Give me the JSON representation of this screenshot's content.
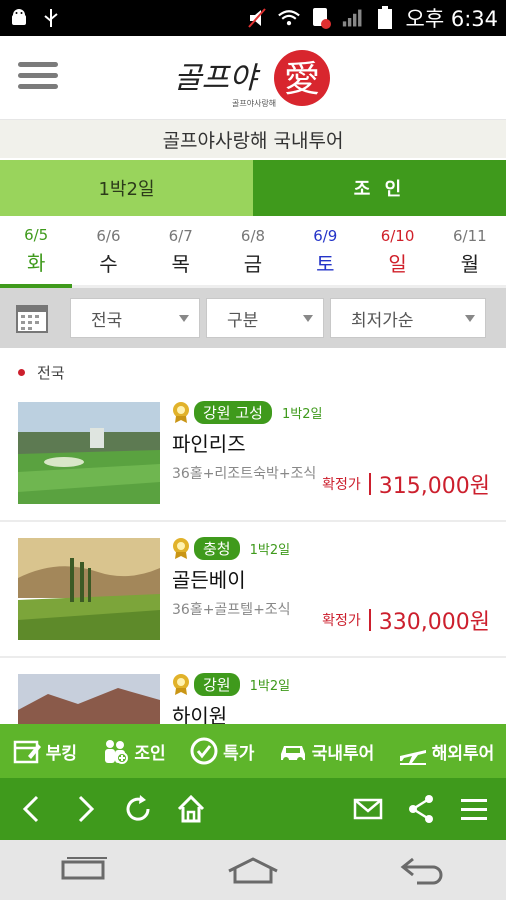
{
  "status_bar": {
    "time": "오후 6:34",
    "left_icons": [
      "android-icon",
      "usb-icon"
    ],
    "right_icons": [
      "mute-icon",
      "wifi-icon",
      "sim-icon",
      "signal-icon",
      "battery-icon"
    ]
  },
  "header": {
    "logo_text": "골프야",
    "logo_small": "골프야사랑해",
    "logo_symbol": "愛",
    "subtitle": "골프야사랑해 국내투어"
  },
  "mode_tabs": [
    {
      "label": "1박2일",
      "active": false
    },
    {
      "label": "조 인",
      "active": true
    }
  ],
  "dates": [
    {
      "date": "6/5",
      "day": "화",
      "active": true
    },
    {
      "date": "6/6",
      "day": "수"
    },
    {
      "date": "6/7",
      "day": "목"
    },
    {
      "date": "6/8",
      "day": "금"
    },
    {
      "date": "6/9",
      "day": "토",
      "type": "sat"
    },
    {
      "date": "6/10",
      "day": "일",
      "type": "sun"
    },
    {
      "date": "6/11",
      "day": "월"
    }
  ],
  "filters": {
    "region": "전국",
    "category": "구분",
    "sort": "최저가순"
  },
  "list": {
    "region_label": "전국",
    "items": [
      {
        "tag": "강원 고성",
        "duration": "1박2일",
        "name": "파인리즈",
        "desc": "36홀+리조트숙박+조식",
        "price_label": "확정가",
        "price": "315,000원"
      },
      {
        "tag": "충청",
        "duration": "1박2일",
        "name": "골든베이",
        "desc": "36홀+골프텔+조식",
        "price_label": "확정가",
        "price": "330,000원"
      },
      {
        "tag": "강원",
        "duration": "1박2일",
        "name": "하이원",
        "desc": "",
        "price_label": "",
        "price": ""
      }
    ]
  },
  "category_bar": [
    {
      "label": "부킹",
      "icon": "booking-icon"
    },
    {
      "label": "조인",
      "icon": "join-icon"
    },
    {
      "label": "특가",
      "icon": "special-icon"
    },
    {
      "label": "국내투어",
      "icon": "car-icon"
    },
    {
      "label": "해외투어",
      "icon": "plane-icon"
    }
  ],
  "browser_bar": [
    "back-icon",
    "forward-icon",
    "refresh-icon",
    "home-icon",
    "mail-icon",
    "share-icon",
    "menu-icon"
  ],
  "colors": {
    "primary": "#3f9a1c",
    "light": "#99d45c",
    "price": "#cc1f2d",
    "sat": "#2434c8",
    "sun": "#d0202a"
  }
}
